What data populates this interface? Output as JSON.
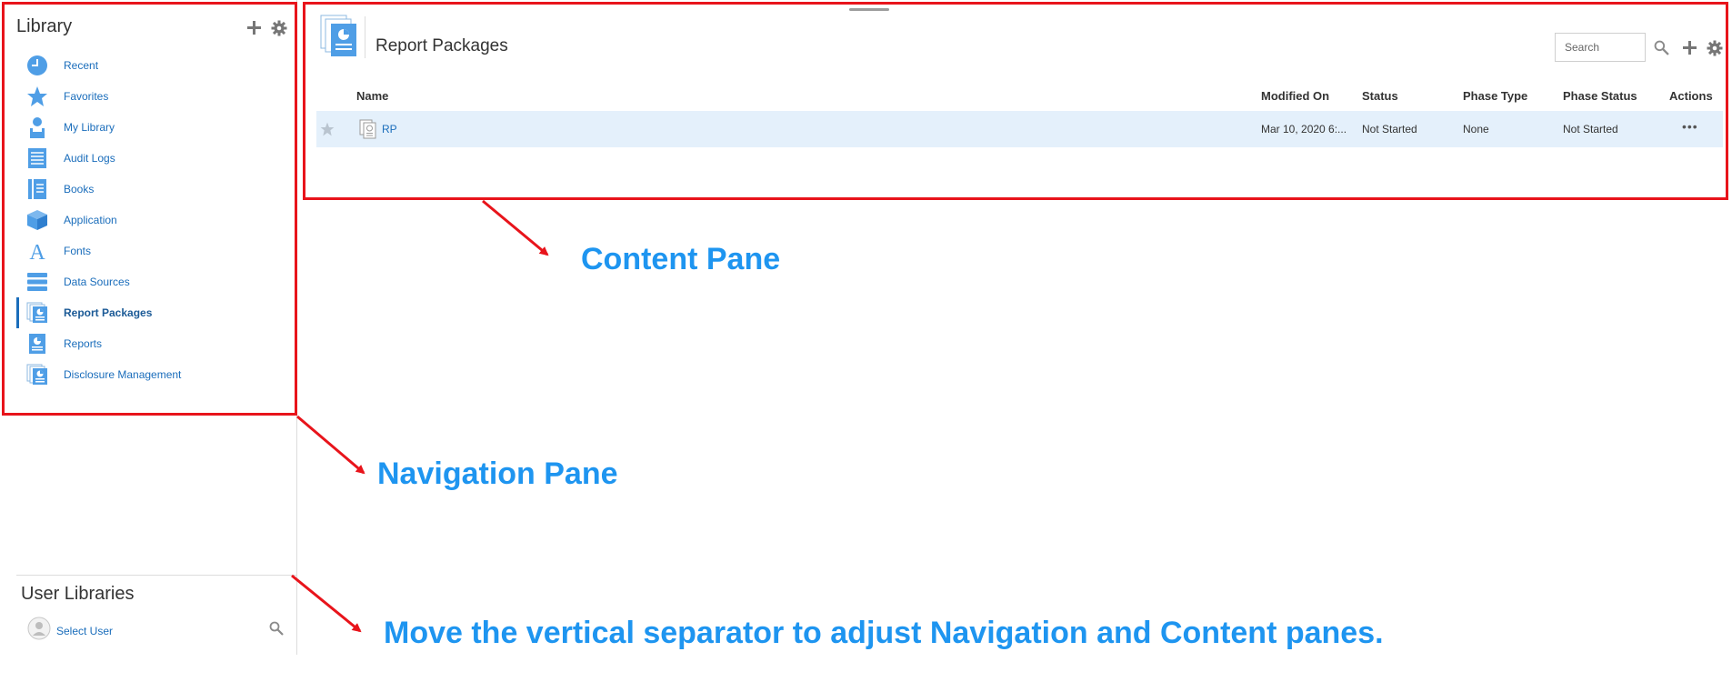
{
  "nav": {
    "title": "Library",
    "add_label": "add",
    "settings_label": "settings",
    "items": [
      {
        "label": "Recent",
        "icon": "clock-icon"
      },
      {
        "label": "Favorites",
        "icon": "star-icon"
      },
      {
        "label": "My Library",
        "icon": "user-icon"
      },
      {
        "label": "Audit Logs",
        "icon": "audit-log-icon"
      },
      {
        "label": "Books",
        "icon": "book-icon"
      },
      {
        "label": "Application",
        "icon": "cube-icon"
      },
      {
        "label": "Fonts",
        "icon": "font-icon"
      },
      {
        "label": "Data Sources",
        "icon": "database-icon"
      },
      {
        "label": "Report Packages",
        "icon": "report-package-icon",
        "selected": true
      },
      {
        "label": "Reports",
        "icon": "report-icon"
      },
      {
        "label": "Disclosure Management",
        "icon": "disclosure-icon"
      }
    ],
    "user_libraries": {
      "title": "User Libraries",
      "select_user": "Select User"
    }
  },
  "content": {
    "title": "Report Packages",
    "search": {
      "placeholder": "Search"
    },
    "columns": [
      "Name",
      "Modified On",
      "Status",
      "Phase Type",
      "Phase Status",
      "Actions"
    ],
    "rows": [
      {
        "name": "RP",
        "modified_on": "Mar 10, 2020 6:...",
        "status": "Not Started",
        "phase_type": "None",
        "phase_status": "Not Started",
        "actions": "•••"
      }
    ]
  },
  "annotations": {
    "content_pane": "Content Pane",
    "navigation_pane": "Navigation Pane",
    "separator_tip": "Move the vertical separator to adjust Navigation and Content panes."
  },
  "colors": {
    "accent": "#1a6dbb",
    "icon_blue": "#4f9ee6",
    "annotation_red": "#e8141b",
    "annotation_blue": "#1e95f0",
    "row_highlight": "#e4f0fb"
  }
}
